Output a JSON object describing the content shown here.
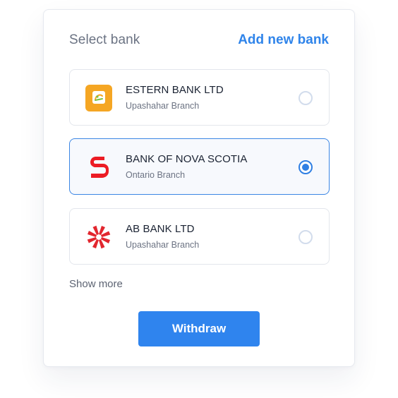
{
  "header": {
    "title": "Select bank",
    "add_link": "Add new bank"
  },
  "banks": [
    {
      "name": "ESTERN BANK LTD",
      "branch": "Upashahar Branch",
      "selected": false,
      "logo_icon": "estern-bank-logo-icon",
      "logo_color": "#f5a623"
    },
    {
      "name": "BANK OF NOVA SCOTIA",
      "branch": "Ontario Branch",
      "selected": true,
      "logo_icon": "scotiabank-logo-icon",
      "logo_color": "#ec1c24"
    },
    {
      "name": "AB BANK LTD",
      "branch": "Upashahar Branch",
      "selected": false,
      "logo_icon": "ab-bank-logo-icon",
      "logo_color": "#e2262e"
    }
  ],
  "show_more": "Show more",
  "withdraw_label": "Withdraw",
  "colors": {
    "accent": "#2f84ee",
    "selected_border": "#3b86e4",
    "radio_unchecked": "#d2dcec"
  }
}
